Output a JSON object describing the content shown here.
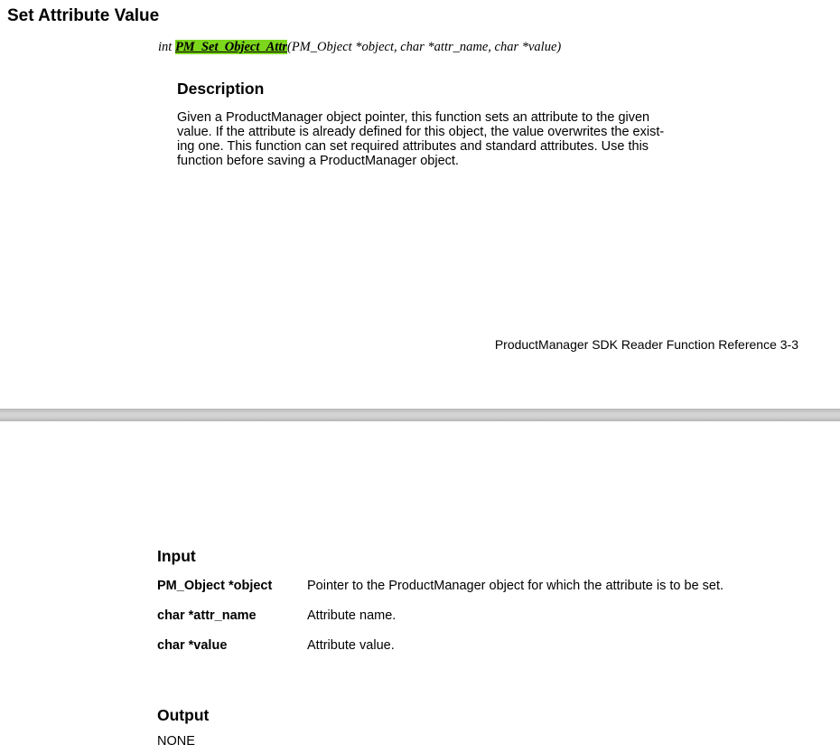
{
  "section_title": "Set Attribute Value",
  "signature": {
    "return_type": "int ",
    "function_name": "PM_Set_Object_Attr",
    "params": "(PM_Object *object, char *attr_name, char *value)",
    "highlight_color": "#7cd61c"
  },
  "description": {
    "heading": "Description",
    "body": "Given a ProductManager object pointer, this function sets an attribute to the given\nvalue. If the attribute is already defined for this object, the value overwrites the exist-\ning one. This function can set required attributes and standard attributes. Use this\nfunction before saving a ProductManager object."
  },
  "footer": "ProductManager SDK Reader Function Reference  3-3",
  "input": {
    "heading": "Input",
    "params": [
      {
        "name": "PM_Object *object",
        "desc": "Pointer to the ProductManager object for which the attribute is to be set."
      },
      {
        "name": "char *attr_name",
        "desc": "Attribute name."
      },
      {
        "name": "char *value",
        "desc": "Attribute value."
      }
    ]
  },
  "output": {
    "heading": "Output",
    "value": "NONE"
  }
}
